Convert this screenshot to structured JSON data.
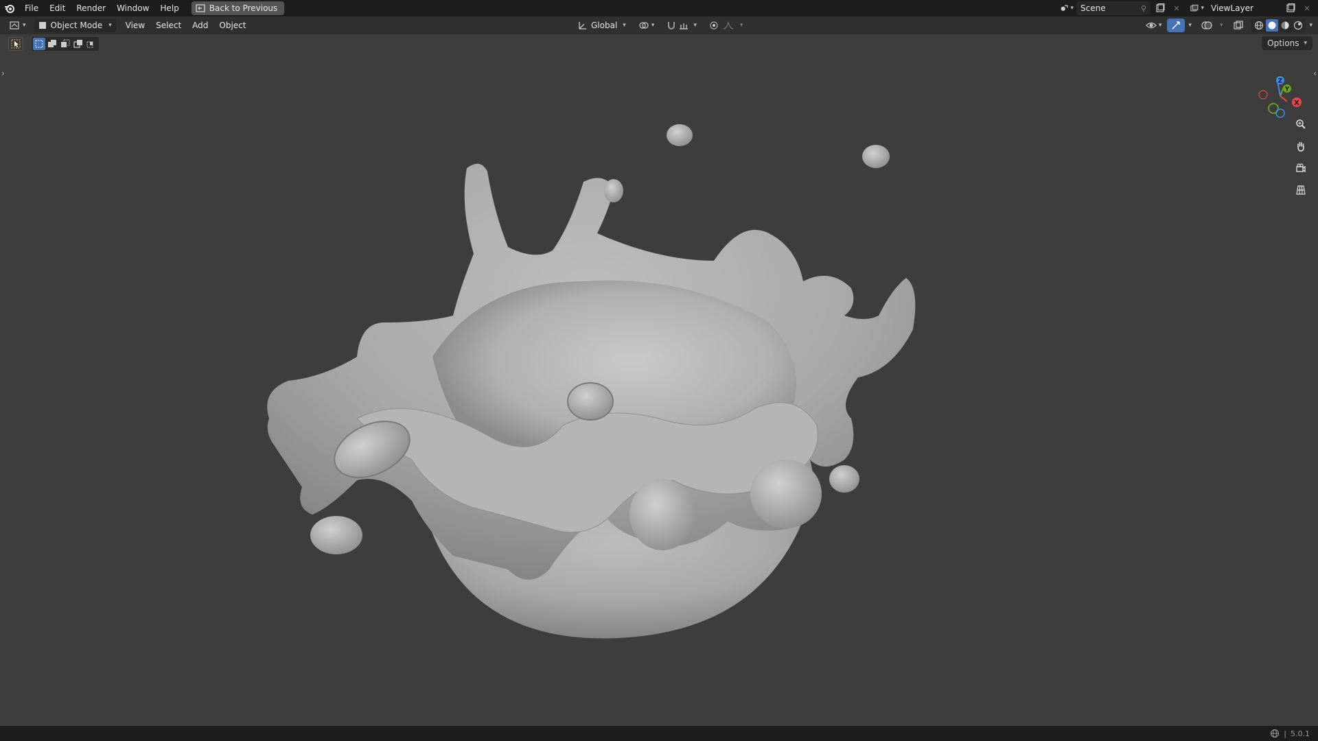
{
  "topbar": {
    "menu": [
      "File",
      "Edit",
      "Render",
      "Window",
      "Help"
    ],
    "back_button": "Back to Previous",
    "scene": "Scene",
    "view_layer": "ViewLayer"
  },
  "header": {
    "mode": "Object Mode",
    "menus": [
      "View",
      "Select",
      "Add",
      "Object"
    ],
    "orientation": "Global"
  },
  "viewport": {
    "options": "Options",
    "gizmo_axes": [
      "X",
      "Y",
      "Z"
    ],
    "object": "splash-crown-mesh"
  },
  "statusbar": {
    "version": "5.0.1"
  },
  "colors": {
    "axis_x": "#e8454f",
    "axis_y": "#6ea31a",
    "axis_z": "#3f8ee6",
    "accent": "#4772b3"
  }
}
